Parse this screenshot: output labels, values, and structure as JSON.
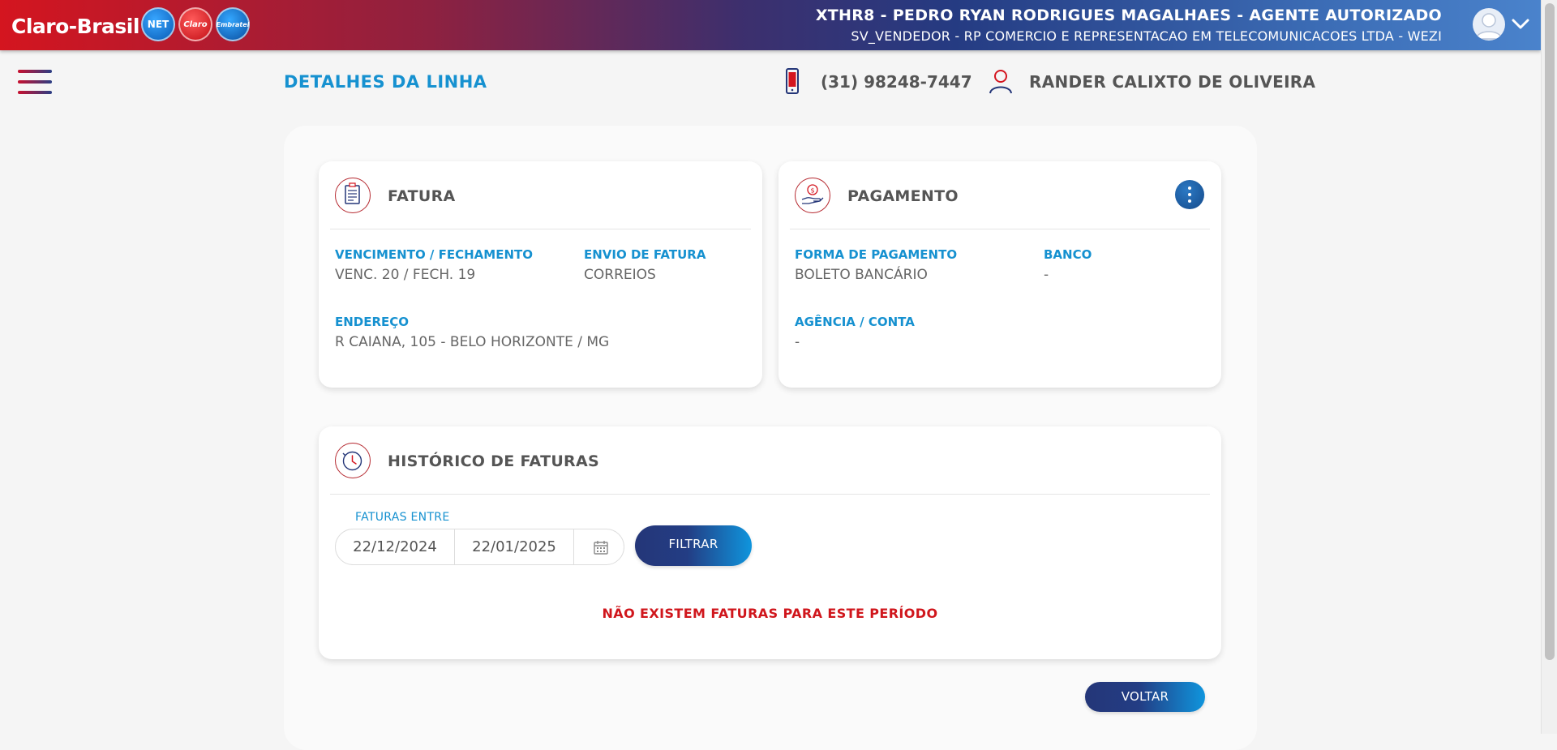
{
  "topbar": {
    "logo_text": "Claro-Brasil",
    "brands": [
      "NET",
      "Claro",
      "Embratel"
    ],
    "agent_title": "XTHR8 - PEDRO RYAN RODRIGUES MAGALHAES - AGENTE AUTORIZADO",
    "agent_subtitle": "SV_VENDEDOR - RP COMERCIO E REPRESENTACAO EM TELECOMUNICACOES LTDA - WEZI",
    "avatar_icon": "user-avatar-icon",
    "menu_toggle_icon": "chevron-down-icon"
  },
  "header": {
    "page_title": "DETALHES DA LINHA",
    "phone": "(31) 98248-7447",
    "customer_name": "RANDER CALIXTO DE OLIVEIRA"
  },
  "fatura": {
    "title": "FATURA",
    "vencimento_label": "VENCIMENTO / FECHAMENTO",
    "vencimento_value": "VENC. 20 / FECH. 19",
    "envio_label": "ENVIO DE FATURA",
    "envio_value": "CORREIOS",
    "endereco_label": "ENDEREÇO",
    "endereco_value": "R CAIANA, 105 - BELO HORIZONTE / MG"
  },
  "pagamento": {
    "title": "PAGAMENTO",
    "forma_label": "FORMA DE PAGAMENTO",
    "forma_value": "BOLETO BANCÁRIO",
    "banco_label": "BANCO",
    "banco_value": "-",
    "agencia_label": "AGÊNCIA / CONTA",
    "agencia_value": "-"
  },
  "historico": {
    "title": "HISTÓRICO DE FATURAS",
    "range_label": "FATURAS ENTRE",
    "date_from": "22/12/2024",
    "date_to": "22/01/2025",
    "filter_label": "FILTRAR",
    "empty_message": "NÃO EXISTEM FATURAS PARA ESTE PERÍODO"
  },
  "footer": {
    "back_label": "VOLTAR"
  },
  "colors": {
    "accent_blue": "#1691d0",
    "error_red": "#d0161c",
    "brand_red": "#d4151f",
    "brand_navy": "#243678"
  }
}
